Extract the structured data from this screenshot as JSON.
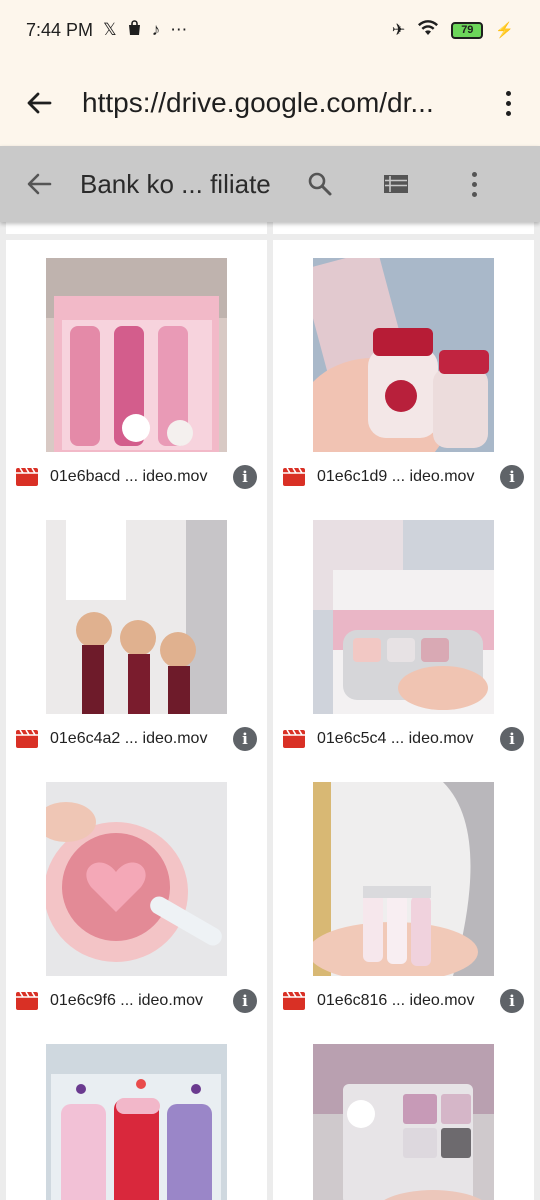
{
  "status": {
    "time": "7:44 PM",
    "left_icons": [
      "x-icon",
      "shopping-bag-icon",
      "tiktok-icon",
      "more-horiz-icon"
    ],
    "battery": "79"
  },
  "browser": {
    "url": "https://drive.google.com/dr..."
  },
  "drive": {
    "title": "Bank ko ... filiate"
  },
  "files": [
    {
      "name": "01e6bacd ... ideo.mov"
    },
    {
      "name": "01e6c1d9 ... ideo.mov"
    },
    {
      "name": "01e6c4a2 ... ideo.mov"
    },
    {
      "name": "01e6c5c4 ... ideo.mov"
    },
    {
      "name": "01e6c9f6 ... ideo.mov"
    },
    {
      "name": "01e6c816 ... ideo.mov"
    }
  ],
  "colors": {
    "status_bg": "#fdf6ec",
    "toolbar_bg": "#c9c9c9",
    "video_red": "#d93025"
  }
}
